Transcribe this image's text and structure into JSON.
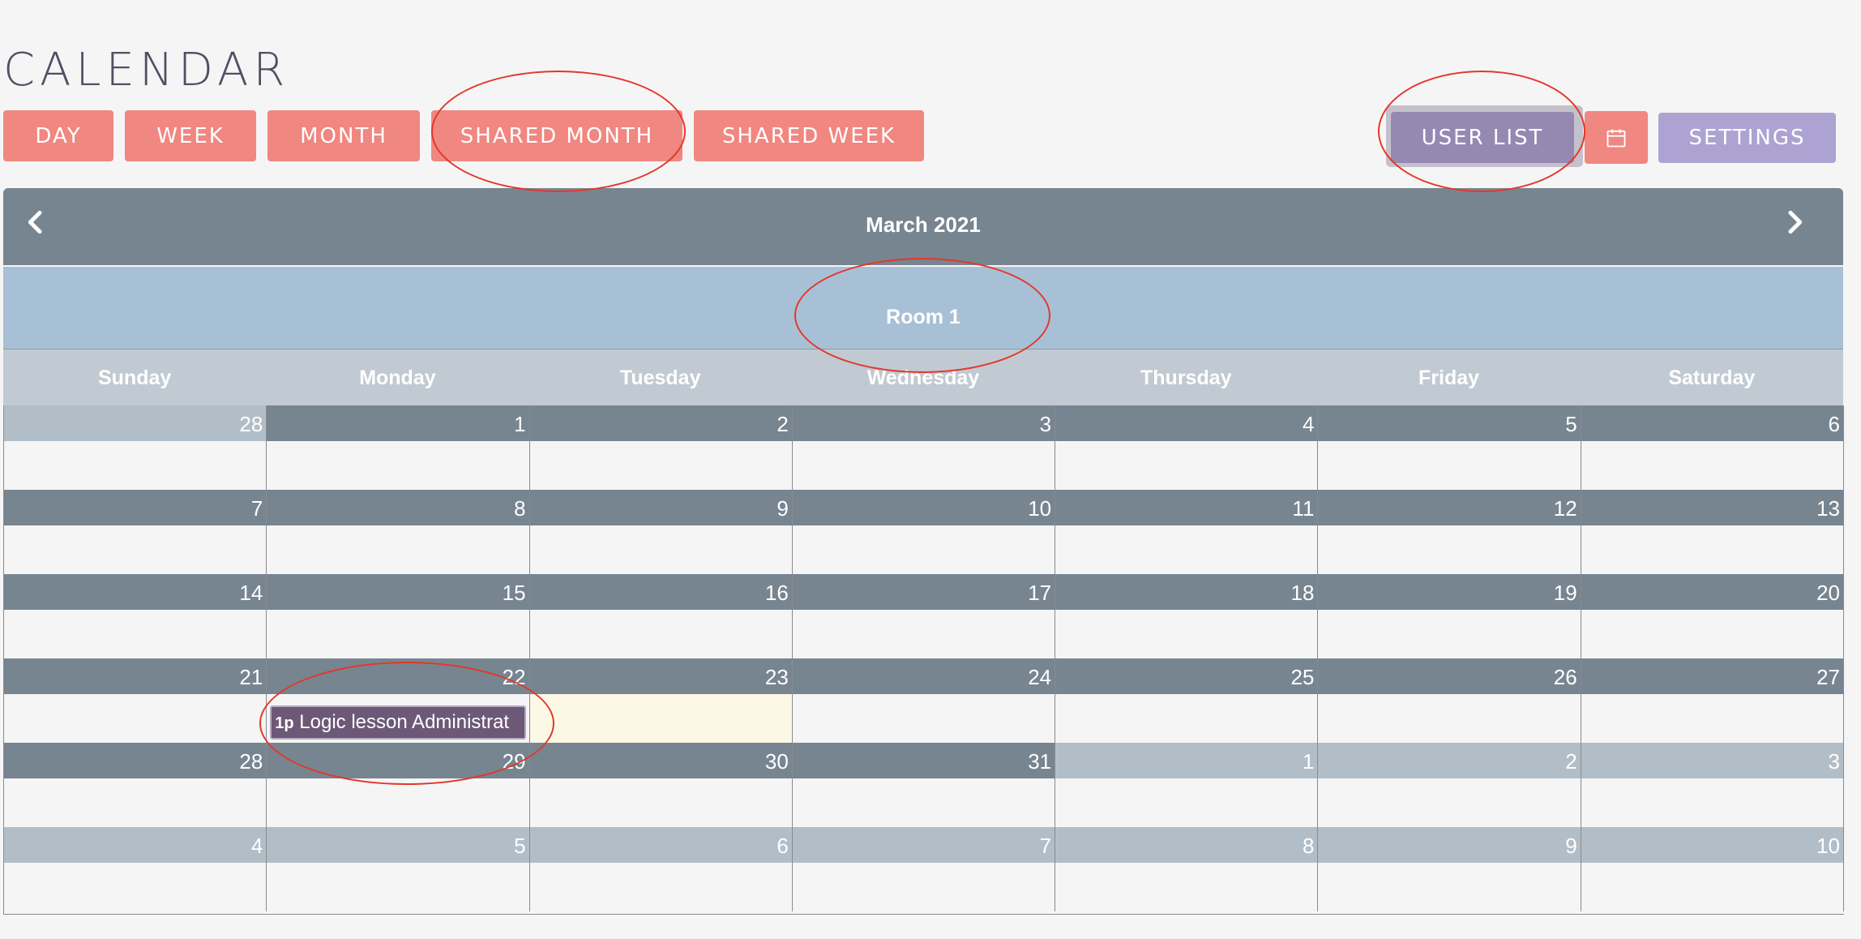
{
  "page": {
    "title": "CALENDAR"
  },
  "view_buttons": [
    {
      "label": "DAY"
    },
    {
      "label": "WEEK"
    },
    {
      "label": "MONTH"
    },
    {
      "label": "SHARED MONTH"
    },
    {
      "label": "SHARED WEEK"
    }
  ],
  "right_buttons": {
    "user_list": "USER LIST",
    "settings": "SETTINGS",
    "calendar_icon": "calendar-icon"
  },
  "calendar": {
    "month_title": "March 2021",
    "room": "Room 1",
    "prev_icon": "chevron-left-icon",
    "next_icon": "chevron-right-icon",
    "weekdays": [
      "Sunday",
      "Monday",
      "Tuesday",
      "Wednesday",
      "Thursday",
      "Friday",
      "Saturday"
    ],
    "weeks": [
      [
        {
          "d": "28",
          "other": true
        },
        {
          "d": "1"
        },
        {
          "d": "2"
        },
        {
          "d": "3"
        },
        {
          "d": "4"
        },
        {
          "d": "5"
        },
        {
          "d": "6"
        }
      ],
      [
        {
          "d": "7"
        },
        {
          "d": "8"
        },
        {
          "d": "9"
        },
        {
          "d": "10"
        },
        {
          "d": "11"
        },
        {
          "d": "12"
        },
        {
          "d": "13"
        }
      ],
      [
        {
          "d": "14"
        },
        {
          "d": "15"
        },
        {
          "d": "16"
        },
        {
          "d": "17"
        },
        {
          "d": "18"
        },
        {
          "d": "19"
        },
        {
          "d": "20"
        }
      ],
      [
        {
          "d": "21"
        },
        {
          "d": "22",
          "event": {
            "time": "1p",
            "title": "Logic lesson Administrat"
          }
        },
        {
          "d": "23",
          "today": true
        },
        {
          "d": "24"
        },
        {
          "d": "25"
        },
        {
          "d": "26"
        },
        {
          "d": "27"
        }
      ],
      [
        {
          "d": "28"
        },
        {
          "d": "29"
        },
        {
          "d": "30"
        },
        {
          "d": "31"
        },
        {
          "d": "1",
          "other": true
        },
        {
          "d": "2",
          "other": true
        },
        {
          "d": "3",
          "other": true
        }
      ],
      [
        {
          "d": "4",
          "other": true
        },
        {
          "d": "5",
          "other": true
        },
        {
          "d": "6",
          "other": true
        },
        {
          "d": "7",
          "other": true
        },
        {
          "d": "8",
          "other": true
        },
        {
          "d": "9",
          "other": true
        },
        {
          "d": "10",
          "other": true
        }
      ]
    ]
  },
  "colors": {
    "view_button": "#f08780",
    "user_list_button": "#9589b2",
    "settings_button": "#ada3d2",
    "header_bar": "#778591",
    "room_bar": "#a8c0d5",
    "event": "#6c5877",
    "annotation": "#e3372a"
  }
}
